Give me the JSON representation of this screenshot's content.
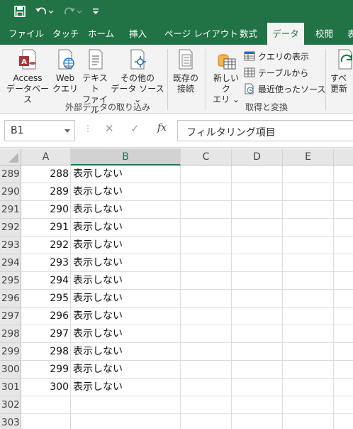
{
  "colors": {
    "brand": "#217346",
    "ribbon_bg": "#f3f3f3",
    "header_bg": "#e6e6e6"
  },
  "tabs": [
    {
      "label": "ファイル"
    },
    {
      "label": "タッチ"
    },
    {
      "label": "ホーム"
    },
    {
      "label": "挿入"
    },
    {
      "label": "ページ レイアウト"
    },
    {
      "label": "数式"
    },
    {
      "label": "データ"
    },
    {
      "label": "校閲"
    },
    {
      "label": "表"
    }
  ],
  "ribbon": {
    "access": {
      "line1": "Access",
      "line2": "データベース"
    },
    "web": {
      "line1": "Web",
      "line2": "クエリ"
    },
    "text": {
      "line1": "テキスト",
      "line2": "ファイル"
    },
    "other": {
      "line1": "その他の",
      "line2": "データ ソース ⌄"
    },
    "existing": {
      "line1": "既存の",
      "line2": "接続"
    },
    "group1_label": "外部データの取り込み",
    "newquery": {
      "line1": "新しいク",
      "line2": "エリ ⌄"
    },
    "show_query": "クエリの表示",
    "from_table": "テーブルから",
    "recent_sources": "最近使ったソース",
    "group2_label": "取得と変換",
    "refresh": {
      "line1": "すべ",
      "line2": "更新"
    }
  },
  "formula_bar": {
    "name_box": "B1",
    "dots": "⋮",
    "cancel": "✕",
    "enter": "✓",
    "fx": "fx",
    "content": "フィルタリング項目"
  },
  "columns": [
    "A",
    "B",
    "C",
    "D",
    "E"
  ],
  "rows": [
    {
      "num": "289",
      "a": "288",
      "b": "表示しない"
    },
    {
      "num": "290",
      "a": "289",
      "b": "表示しない"
    },
    {
      "num": "291",
      "a": "290",
      "b": "表示しない"
    },
    {
      "num": "292",
      "a": "291",
      "b": "表示しない"
    },
    {
      "num": "293",
      "a": "292",
      "b": "表示しない"
    },
    {
      "num": "294",
      "a": "293",
      "b": "表示しない"
    },
    {
      "num": "295",
      "a": "294",
      "b": "表示しない"
    },
    {
      "num": "296",
      "a": "295",
      "b": "表示しない"
    },
    {
      "num": "297",
      "a": "296",
      "b": "表示しない"
    },
    {
      "num": "298",
      "a": "297",
      "b": "表示しない"
    },
    {
      "num": "299",
      "a": "298",
      "b": "表示しない"
    },
    {
      "num": "300",
      "a": "299",
      "b": "表示しない"
    },
    {
      "num": "301",
      "a": "300",
      "b": "表示しない"
    },
    {
      "num": "302",
      "a": "",
      "b": ""
    },
    {
      "num": "303",
      "a": "",
      "b": ""
    }
  ]
}
